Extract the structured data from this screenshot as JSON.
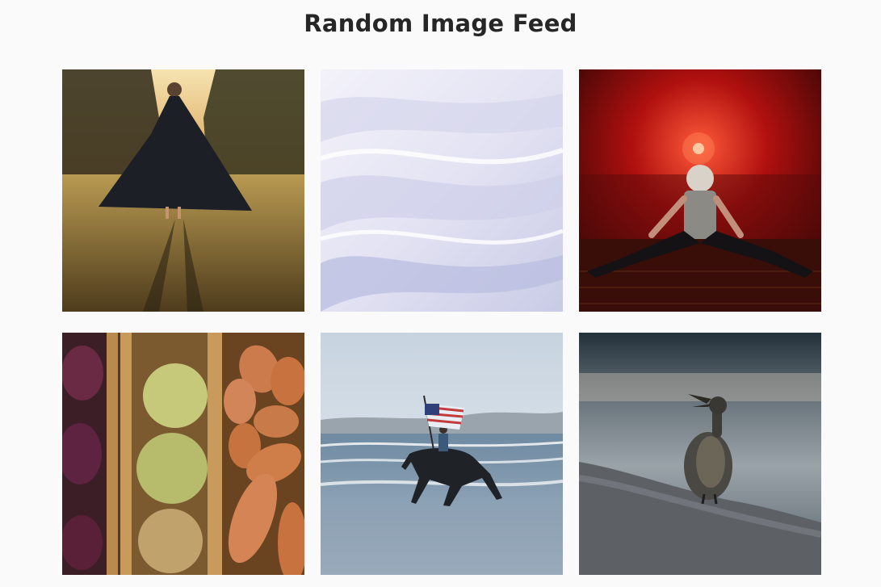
{
  "feed": {
    "title": "Random Image Feed",
    "images": [
      {
        "description": "woman in dark cloak dancing in a sunlit meadow"
      },
      {
        "description": "white silk fabric waves"
      },
      {
        "description": "woman with grey hair sitting under red light"
      },
      {
        "description": "crates of purple cabbage, celery root and sweet potatoes"
      },
      {
        "description": "rider on horse carrying american flag in the surf"
      },
      {
        "description": "cormorant bird with open beak on pebble beach"
      }
    ]
  }
}
